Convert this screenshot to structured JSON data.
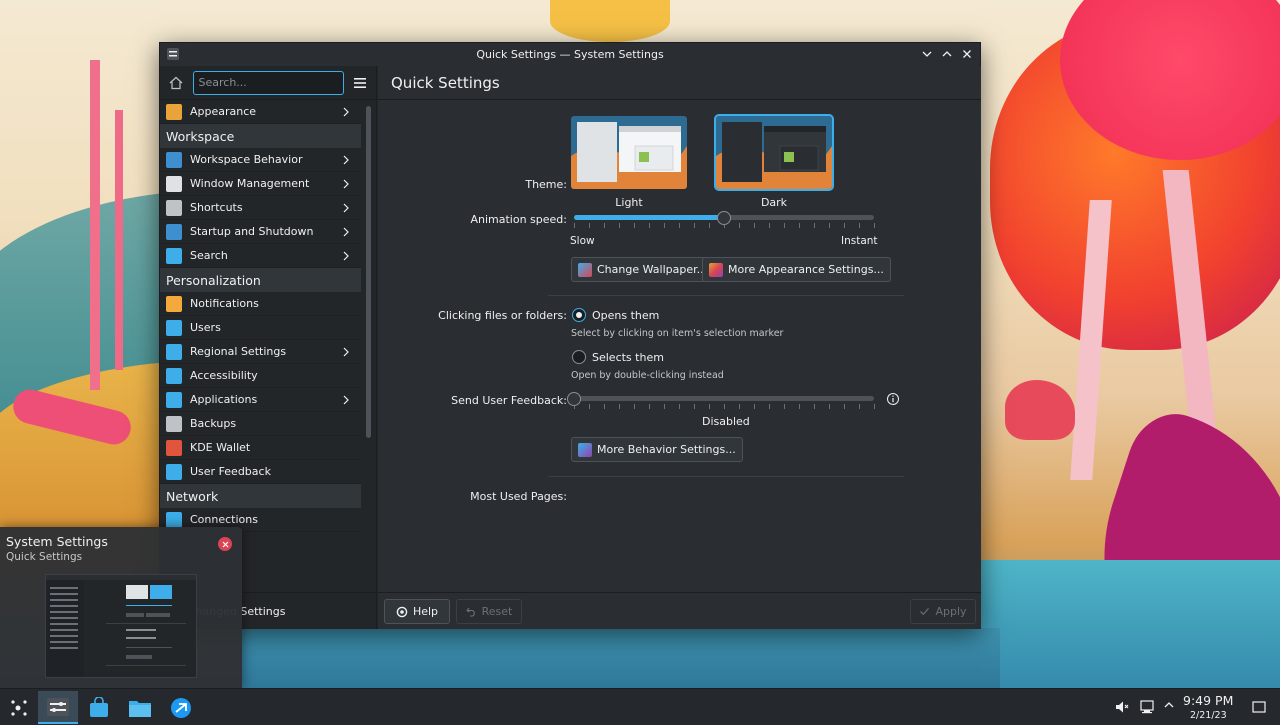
{
  "window": {
    "title": "Quick Settings — System Settings"
  },
  "sidebar": {
    "search_placeholder": "Search...",
    "top_items": [
      {
        "label": "Appearance",
        "icon": "appearance-icon",
        "color": "#e8a33a",
        "chevron": true
      }
    ],
    "categories": [
      {
        "name": "Workspace",
        "items": [
          {
            "label": "Workspace Behavior",
            "icon": "workspace-behavior-icon",
            "color": "#3e8fd0",
            "chevron": true
          },
          {
            "label": "Window Management",
            "icon": "window-management-icon",
            "color": "#dfe1e3",
            "chevron": true
          },
          {
            "label": "Shortcuts",
            "icon": "keyboard-icon",
            "color": "#bfc3c7",
            "chevron": true
          },
          {
            "label": "Startup and Shutdown",
            "icon": "startup-shutdown-icon",
            "color": "#3e8fd0",
            "chevron": true
          },
          {
            "label": "Search",
            "icon": "search-icon",
            "color": "#3daee9",
            "chevron": true
          }
        ]
      },
      {
        "name": "Personalization",
        "items": [
          {
            "label": "Notifications",
            "icon": "bell-icon",
            "color": "#f3a93c",
            "chevron": false
          },
          {
            "label": "Users",
            "icon": "users-icon",
            "color": "#3daee9",
            "chevron": false
          },
          {
            "label": "Regional Settings",
            "icon": "regional-settings-icon",
            "color": "#3daee9",
            "chevron": true
          },
          {
            "label": "Accessibility",
            "icon": "accessibility-icon",
            "color": "#3daee9",
            "chevron": false
          },
          {
            "label": "Applications",
            "icon": "applications-icon",
            "color": "#3daee9",
            "chevron": true
          },
          {
            "label": "Backups",
            "icon": "backups-icon",
            "color": "#bfc3c7",
            "chevron": false
          },
          {
            "label": "KDE Wallet",
            "icon": "wallet-icon",
            "color": "#e0553b",
            "chevron": false
          },
          {
            "label": "User Feedback",
            "icon": "feedback-icon",
            "color": "#3daee9",
            "chevron": false
          }
        ]
      },
      {
        "name": "Network",
        "items": [
          {
            "label": "Connections",
            "icon": "globe-icon",
            "color": "#3daee9",
            "chevron": false
          }
        ]
      }
    ],
    "bottom_label": "ght Changed Settings"
  },
  "content": {
    "page_title": "Quick Settings",
    "theme_label": "Theme:",
    "themes": [
      {
        "name": "Light",
        "selected": false
      },
      {
        "name": "Dark",
        "selected": true
      }
    ],
    "animation_label": "Animation speed:",
    "animation_value": 0.5,
    "animation_min_label": "Slow",
    "animation_max_label": "Instant",
    "change_wallpaper_button": "Change Wallpaper...",
    "more_appearance_button": "More Appearance Settings...",
    "clicking_label": "Clicking files or folders:",
    "click_options": [
      {
        "label": "Opens them",
        "hint": "Select by clicking on item's selection marker",
        "checked": true
      },
      {
        "label": "Selects them",
        "hint": "Open by double-clicking instead",
        "checked": false
      }
    ],
    "feedback_label": "Send User Feedback:",
    "feedback_value": 0,
    "feedback_status": "Disabled",
    "more_behavior_button": "More Behavior Settings...",
    "most_used_label": "Most Used Pages:",
    "help_button": "Help",
    "reset_button": "Reset",
    "apply_button": "Apply"
  },
  "notification": {
    "title": "System Settings",
    "subtitle": "Quick Settings"
  },
  "taskbar": {
    "time": "9:49 PM",
    "date": "2/21/23"
  },
  "colors": {
    "accent": "#3daee9",
    "window_bg": "#232629",
    "content_bg": "#2a2e32",
    "close_red": "#da4453"
  }
}
